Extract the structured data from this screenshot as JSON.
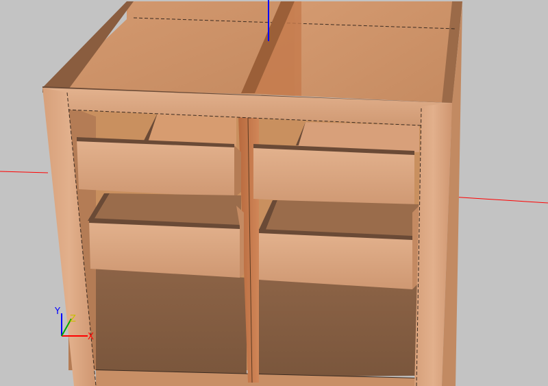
{
  "viewport": {
    "axis_labels": {
      "x": "X",
      "y": "Y",
      "z": "Z"
    }
  },
  "colors": {
    "background": "#c3c3c3",
    "axis_x": "#ff0000",
    "axis_y": "#00aa00",
    "axis_z": "#0000ff",
    "wood_light": "#d9a27c",
    "wood_mid": "#c98d64",
    "wood_dark": "#9c6a47",
    "wood_floor": "#8e6546",
    "edge": "#3a2a20"
  }
}
